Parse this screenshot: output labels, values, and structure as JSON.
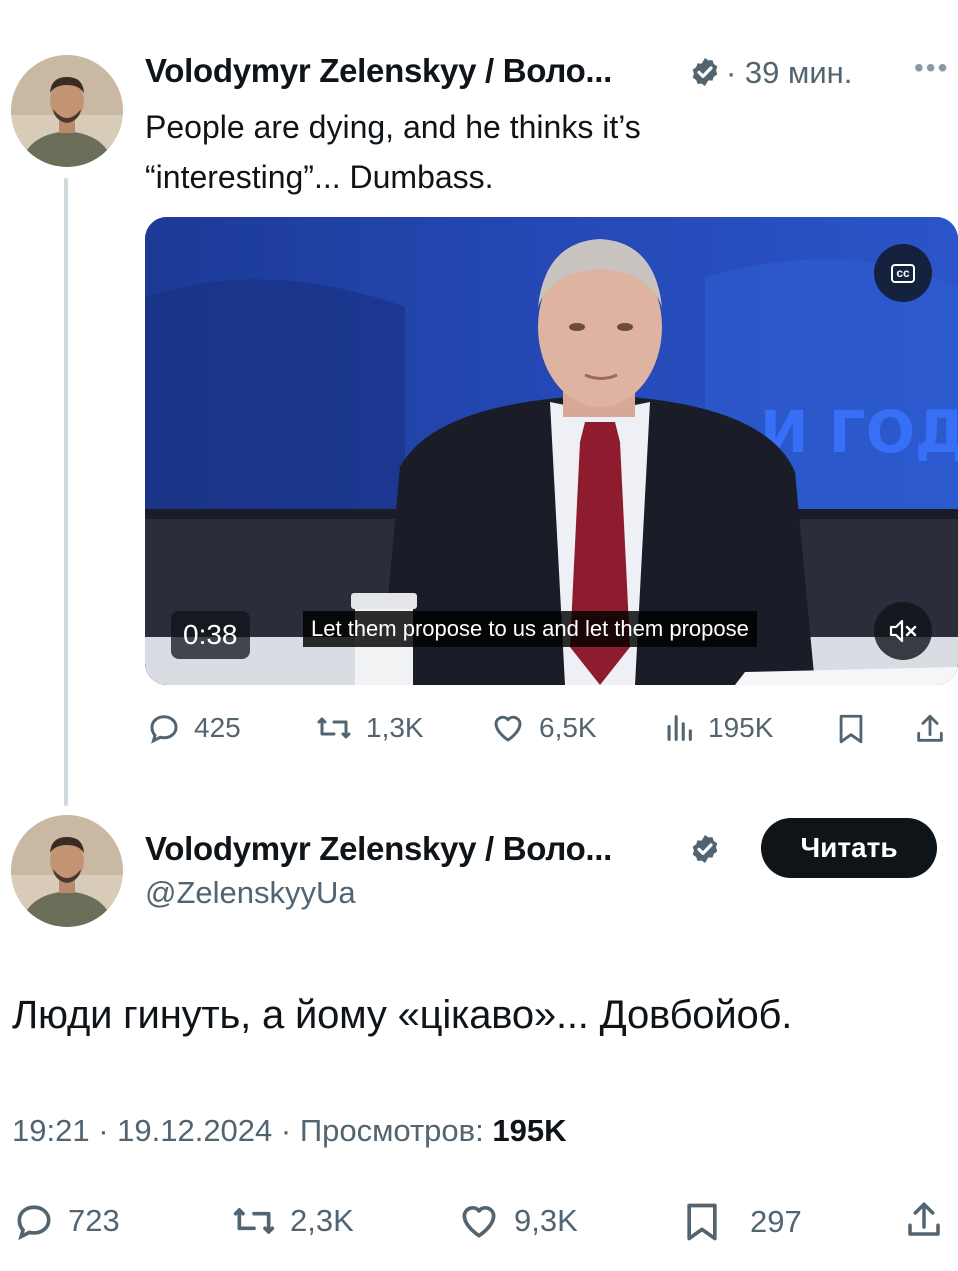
{
  "colors": {
    "text": "#0f1419",
    "secondary": "#536471",
    "verified": "#536471",
    "follow_bg": "#0f1419"
  },
  "tweet1": {
    "author_name": "Volodymyr Zelenskyy / Воло...",
    "time": "· 39 мин.",
    "more_icon": "more-dots-icon",
    "text_line1": "People are dying, and he thinks it’s",
    "text_line2": "“interesting”... Dumbass.",
    "video": {
      "duration": "0:38",
      "subtitle": "Let them propose to us and let them propose",
      "background_text": "И ГОДА",
      "cc_label": "cc"
    },
    "actions": {
      "replies": "425",
      "reposts": "1,3K",
      "likes": "6,5K",
      "views": "195K"
    }
  },
  "tweet2": {
    "author_name": "Volodymyr Zelenskyy / Воло...",
    "handle": "@ZelenskyyUa",
    "follow_label": "Читать",
    "text": "Люди гинуть, а йому «цікаво»... Довбойоб.",
    "timestamp": "19:21 · 19.12.2024 · Просмотров: ",
    "views": "195K",
    "actions": {
      "replies": "723",
      "reposts": "2,3K",
      "likes": "9,3K",
      "bookmarks": "297"
    }
  }
}
